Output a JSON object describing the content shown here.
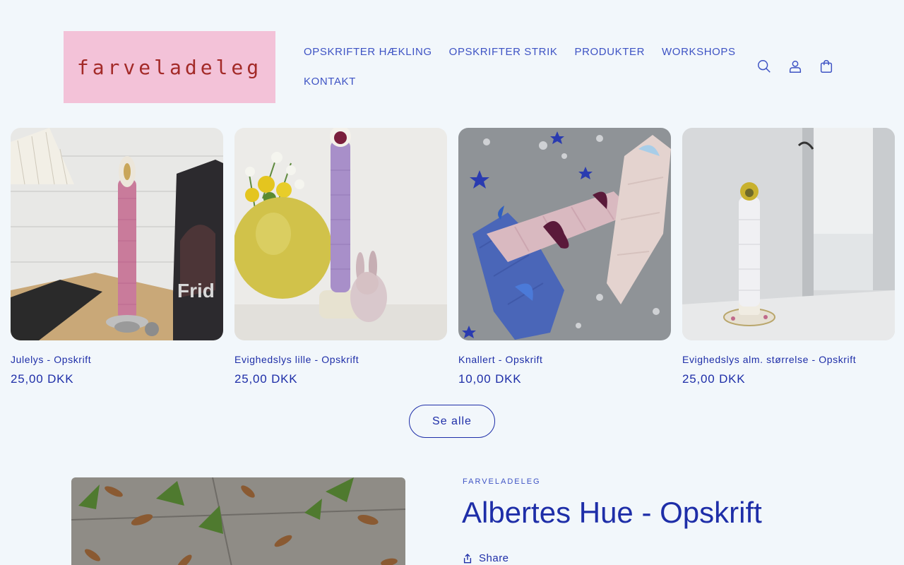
{
  "brand": {
    "logo_text": "farveladeleg",
    "logo_bg": "#f3c2d8",
    "logo_color": "#a32a28"
  },
  "nav": {
    "row1": [
      "OPSKRIFTER HÆKLING",
      "OPSKRIFTER STRIK",
      "PRODUKTER",
      "WORKSHOPS"
    ],
    "row2": [
      "KONTAKT"
    ]
  },
  "header_icons": [
    "search-icon",
    "account-icon",
    "cart-icon"
  ],
  "products": [
    {
      "title": "Julelys - Opskrift",
      "price": "25,00 DKK"
    },
    {
      "title": "Evighedslys lille - Opskrift",
      "price": "25,00 DKK"
    },
    {
      "title": "Knallert - Opskrift",
      "price": "10,00 DKK"
    },
    {
      "title": "Evighedslys alm. størrelse - Opskrift",
      "price": "25,00 DKK"
    }
  ],
  "see_all_label": "Se alle",
  "featured": {
    "vendor": "FARVELADELEG",
    "title": "Albertes Hue - Opskrift",
    "share_label": "Share"
  },
  "colors": {
    "background": "#f2f7fb",
    "accent": "#1e2ea8",
    "nav": "#3e53c4"
  }
}
